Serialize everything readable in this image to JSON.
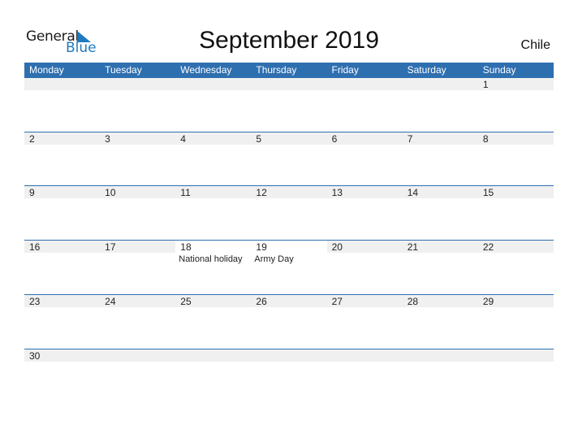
{
  "logo": {
    "text_general": "General",
    "text_blue": "Blue",
    "icon": "triangle-flag-icon",
    "accent": "#1f7abf"
  },
  "title": "September 2019",
  "country": "Chile",
  "header_color": "#2e6fb0",
  "weekdays": [
    "Monday",
    "Tuesday",
    "Wednesday",
    "Thursday",
    "Friday",
    "Saturday",
    "Sunday"
  ],
  "weeks": [
    [
      null,
      null,
      null,
      null,
      null,
      null,
      {
        "day": "1"
      }
    ],
    [
      {
        "day": "2"
      },
      {
        "day": "3"
      },
      {
        "day": "4"
      },
      {
        "day": "5"
      },
      {
        "day": "6"
      },
      {
        "day": "7"
      },
      {
        "day": "8"
      }
    ],
    [
      {
        "day": "9"
      },
      {
        "day": "10"
      },
      {
        "day": "11"
      },
      {
        "day": "12"
      },
      {
        "day": "13"
      },
      {
        "day": "14"
      },
      {
        "day": "15"
      }
    ],
    [
      {
        "day": "16"
      },
      {
        "day": "17"
      },
      {
        "day": "18",
        "event": "National holiday"
      },
      {
        "day": "19",
        "event": "Army Day"
      },
      {
        "day": "20"
      },
      {
        "day": "21"
      },
      {
        "day": "22"
      }
    ],
    [
      {
        "day": "23"
      },
      {
        "day": "24"
      },
      {
        "day": "25"
      },
      {
        "day": "26"
      },
      {
        "day": "27"
      },
      {
        "day": "28"
      },
      {
        "day": "29"
      }
    ],
    [
      {
        "day": "30"
      },
      null,
      null,
      null,
      null,
      null,
      null
    ]
  ]
}
